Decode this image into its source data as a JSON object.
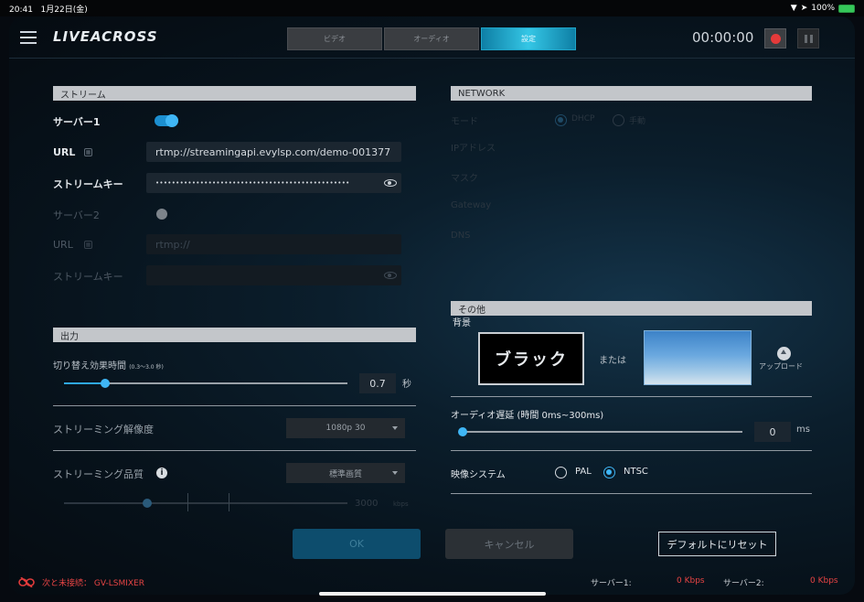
{
  "statusbar": {
    "time": "20:41",
    "date": "1月22日(金)",
    "battery": "100%"
  },
  "header": {
    "logo": "LIVEACROSS",
    "tabs": [
      {
        "label": "ビデオ",
        "active": false
      },
      {
        "label": "オーディオ",
        "active": false
      },
      {
        "label": "設定",
        "active": true
      }
    ],
    "timer": "00:00:00"
  },
  "stream": {
    "title": "ストリーム",
    "server1_label": "サーバー1",
    "server1_enabled": true,
    "url_label": "URL",
    "url1_value": "rtmp://streamingapi.evylsp.com/demo-001377",
    "key_label": "ストリームキー",
    "key1_value": "••••••••••••••••••••••••••••••••••••••••••••••••",
    "server2_label": "サーバー2",
    "server2_enabled": false,
    "url2_label": "URL",
    "url2_value": "rtmp://",
    "key2_label": "ストリームキー"
  },
  "output": {
    "title": "出力",
    "transition_label": "切り替え効果時間",
    "transition_range": "(0.3～3.0 秒)",
    "transition_value": 0.7,
    "transition_value_text": "0.7",
    "transition_unit": "秒",
    "resolution_label": "ストリーミング解像度",
    "resolution_value": "1080p 30",
    "quality_label": "ストリーミング品質",
    "quality_value": "標準画質",
    "bitrate_value": "3000",
    "bitrate_unit": "kbps"
  },
  "network": {
    "title": "NETWORK",
    "mode_label": "モード",
    "mode_options": [
      "DHCP",
      "手動"
    ],
    "mode_selected": "DHCP",
    "ip_label": "IPアドレス",
    "mask_label": "マスク",
    "gateway_label": "Gateway",
    "dns_label": "DNS"
  },
  "other": {
    "title": "その他",
    "bg_label": "背景",
    "bg_black": "ブラック",
    "or_text": "または",
    "upload_label": "アップロード",
    "audio_delay_label": "オーディオ遅延 (時間 0ms~300ms)",
    "audio_delay_value": 0,
    "audio_delay_text": "0",
    "audio_delay_unit": "ms",
    "video_system_label": "映像システム",
    "video_system_options": [
      "PAL",
      "NTSC"
    ],
    "video_system_selected": "NTSC"
  },
  "buttons": {
    "ok": "OK",
    "cancel": "キャンセル",
    "reset": "デフォルトにリセット"
  },
  "footer": {
    "connection_text": "次と未接続： GV-LSMIXER",
    "server1_label": "サーバー1:",
    "server1_rate": "0 Kbps",
    "server2_label": "サーバー2:",
    "server2_rate": "0 Kbps"
  },
  "colors": {
    "accent": "#3fb6f5",
    "warning": "#e43a3a",
    "section_header": "#c3c6ca"
  }
}
